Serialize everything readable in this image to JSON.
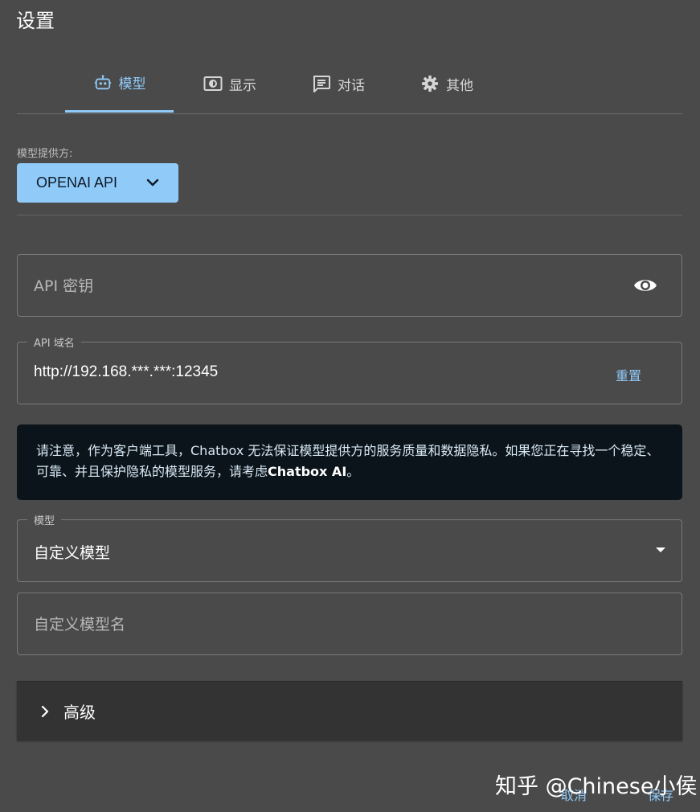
{
  "dialog": {
    "title": "设置"
  },
  "tabs": [
    {
      "label": "模型",
      "icon": "robot-icon",
      "active": true
    },
    {
      "label": "显示",
      "icon": "display-icon",
      "active": false
    },
    {
      "label": "对话",
      "icon": "chat-icon",
      "active": false
    },
    {
      "label": "其他",
      "icon": "gear-icon",
      "active": false
    }
  ],
  "provider": {
    "label": "模型提供方:",
    "selected": "OPENAI API"
  },
  "api_key": {
    "placeholder": "API 密钥",
    "value": ""
  },
  "api_host": {
    "legend": "API 域名",
    "value": "http://192.168.***.***:12345",
    "reset_label": "重置"
  },
  "notice": {
    "text_before": "请注意，作为客户端工具，Chatbox 无法保证模型提供方的服务质量和数据隐私。如果您正在寻找一个稳定、可靠、并且保护隐私的模型服务，请考虑",
    "link_text": "Chatbox AI",
    "text_after": "。"
  },
  "model": {
    "legend": "模型",
    "selected": "自定义模型"
  },
  "custom_model": {
    "placeholder": "自定义模型名"
  },
  "advanced": {
    "label": "高级"
  },
  "footer": {
    "cancel_label": "取消",
    "save_label": "保存"
  },
  "watermark": {
    "text": "知乎 @Chinese小侯"
  },
  "colors": {
    "accent": "#90caf9",
    "background": "#4a4a4a",
    "notice_bg": "#0b141a"
  }
}
